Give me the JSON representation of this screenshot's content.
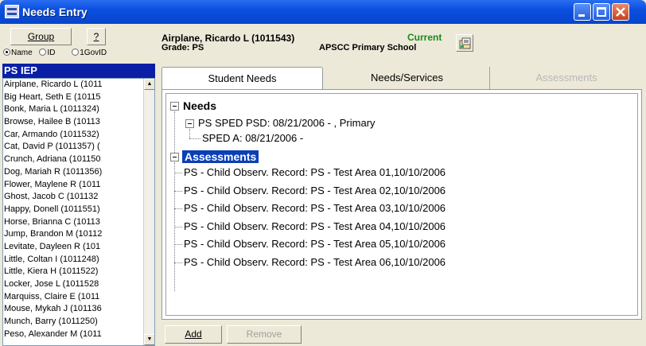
{
  "window": {
    "title": "Needs Entry"
  },
  "left_panel": {
    "group_label": "Group",
    "help_label": "?",
    "radio_options": [
      {
        "label": "Name",
        "selected": true
      },
      {
        "label": "ID",
        "selected": false
      },
      {
        "label": "1GovID",
        "selected": false
      }
    ],
    "group_header": "PS IEP",
    "students": [
      "Airplane, Ricardo L (1011",
      "Big Heart, Seth E (10115",
      "Bonk, Maria L (1011324)",
      "Browse, Hailee B (10113",
      "Car, Armando (1011532)",
      "Cat, David P (1011357) (",
      "Crunch, Adriana (101150",
      "Dog, Mariah R (1011356)",
      "Flower, Maylene R (1011",
      "Ghost, Jacob C (101132",
      "Happy, Donell (1011551)",
      "Horse, Brianna C (10113",
      "Jump, Brandon M (10112",
      "Levitate, Dayleen R (101",
      "Little, Coltan I (1011248) ",
      "Little, Kiera H (1011522) ",
      "Locker, Jose L (1011528",
      "Marquiss, Claire E (1011",
      "Mouse, Mykah J (101136",
      "Munch, Barry (1011250)",
      "Peso, Alexander M (1011"
    ]
  },
  "student_header": {
    "name": "Airplane, Ricardo L (1011543)",
    "grade": "Grade: PS",
    "status": "Current",
    "school": "APSCC Primary School"
  },
  "tabs": [
    {
      "label": "Student Needs",
      "state": "active"
    },
    {
      "label": "Needs/Services",
      "state": "normal"
    },
    {
      "label": "Assessments",
      "state": "disabled"
    }
  ],
  "tree": {
    "needs_label": "Needs",
    "sped_psd": "PS SPED PSD: 08/21/2006 - , Primary",
    "sped_a": "SPED A: 08/21/2006 -",
    "assessments_label": "Assessments",
    "assessment_items": [
      "PS - Child Observ. Record: PS - Test  Area 01,10/10/2006",
      "PS - Child Observ. Record: PS - Test  Area 02,10/10/2006",
      "PS - Child Observ. Record: PS - Test  Area 03,10/10/2006",
      "PS - Child Observ. Record: PS - Test  Area 04,10/10/2006",
      "PS - Child Observ. Record: PS - Test  Area 05,10/10/2006",
      "PS - Child Observ. Record: PS - Test  Area 06,10/10/2006"
    ]
  },
  "actions": {
    "add_label": "Add",
    "remove_label": "Remove"
  },
  "colors": {
    "titlebar": "#0a4fe0",
    "group_header_bg": "#0a1fa5",
    "status_green": "#1a8a1a",
    "selection": "#0a3fb5"
  }
}
